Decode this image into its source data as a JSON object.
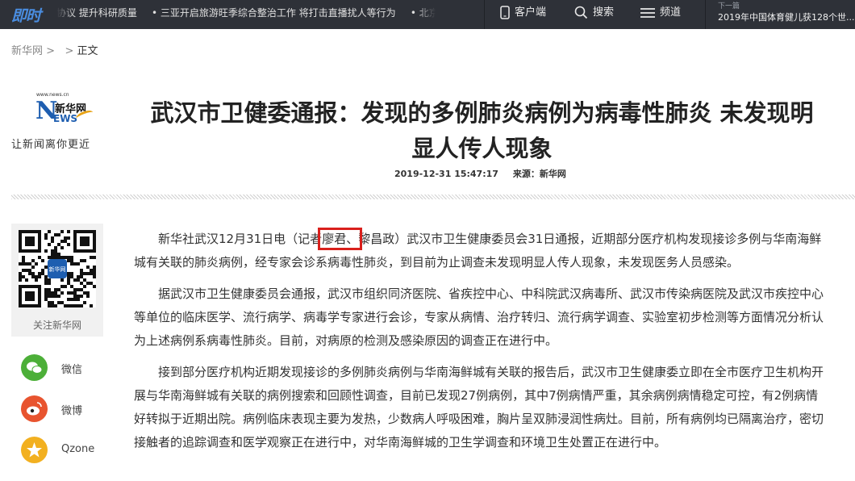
{
  "topbar": {
    "logo": "即时",
    "ticker": [
      "协议 提升科研质量",
      "• 三亚开启旅游旺季综合整治工作 将打击直播扰人等行为",
      "• 北京推"
    ],
    "client_label": "客户端",
    "search_label": "搜索",
    "channel_label": "频道",
    "next_label": "下一篇",
    "next_title": "2019年中国体育健儿获128个世..."
  },
  "breadcrumb": {
    "home": "新华网",
    "sep1": ">",
    "sep2": ">",
    "current": "正文"
  },
  "masthead": {
    "url": "www.news.cn",
    "n": "N",
    "cn": "新华网",
    "ews": "EWS",
    "slogan": "让新闻离你更近"
  },
  "article": {
    "title_line1": "武汉市卫健委通报：发现的多例肺炎病例为病毒性肺炎 未发现明",
    "title_line2": "显人传人现象",
    "datetime": "2019-12-31 15:47:17",
    "source": "来源：新华网",
    "p1_a": "新华社武汉12月31日电（记者",
    "p1_hl": "廖君、",
    "p1_b": "黎昌政）武汉市卫生健康委员会31日通报，近期部分医疗机构发现接诊多例与华南海鲜",
    "p1_l2": "城有关联的肺炎病例，经专家会诊系病毒性肺炎，到目前为止调查未发现明显人传人现象，未发现医务人员感染。",
    "p2_l1": "据武汉市卫生健康委员会通报，武汉市组织同济医院、省疾控中心、中科院武汉病毒所、武汉市传染病医院及武汉市疾控中心",
    "p2_l2": "等单位的临床医学、流行病学、病毒学专家进行会诊，专家从病情、治疗转归、流行病学调查、实验室初步检测等方面情况分析认",
    "p2_l3": "为上述病例系病毒性肺炎。目前，对病原的检测及感染原因的调查正在进行中。",
    "p3_l1": "接到部分医疗机构近期发现接诊的多例肺炎病例与华南海鲜城有关联的报告后，武汉市卫生健康委立即在全市医疗卫生机构开",
    "p3_l2": "展与华南海鲜城有关联的病例搜索和回顾性调查，目前已发现27例病例，其中7例病情严重，其余病例病情稳定可控，有2例病情",
    "p3_l3": "好转拟于近期出院。病例临床表现主要为发热，少数病人呼吸困难，胸片呈双肺浸润性病灶。目前，所有病例均已隔离治疗，密切",
    "p3_l4": "接触者的追踪调查和医学观察正在进行中，对华南海鲜城的卫生学调查和环境卫生处置正在进行中。"
  },
  "sidebar": {
    "qr_label": "关注新华网",
    "qr_center": "新华网",
    "share": [
      {
        "label": "微信",
        "icon": "wechat-icon",
        "color": "#4caf38"
      },
      {
        "label": "微博",
        "icon": "weibo-icon",
        "color": "#e8542f"
      },
      {
        "label": "Qzone",
        "icon": "qzone-icon",
        "color": "#f2b020"
      }
    ]
  },
  "colors": {
    "topbar": "#2e3138",
    "highlight_box": "#d9201c",
    "logo_blue": "#1e5eb0"
  }
}
